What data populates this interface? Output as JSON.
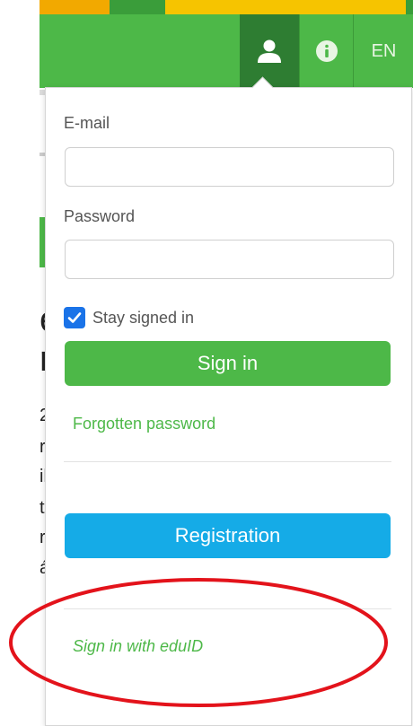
{
  "header": {
    "user_button_icon": "user-icon",
    "info_button_icon": "info-icon",
    "language_label": "EN"
  },
  "login": {
    "email_label": "E-mail",
    "email_value": "",
    "password_label": "Password",
    "password_value": "",
    "stay_signed_in_label": "Stay signed in",
    "stay_signed_in_checked": true,
    "sign_in_label": "Sign in",
    "forgotten_password_label": "Forgotten password",
    "registration_label": "Registration",
    "eduid_label": "Sign in with eduID"
  },
  "background_fragments": [
    "e",
    "r",
    "2",
    "r",
    "ik",
    "t",
    "r",
    "á"
  ],
  "colors": {
    "brand_green": "#4db848",
    "dark_green": "#2e7d32",
    "registration_blue": "#15abe7",
    "checkbox_blue": "#1a73e8",
    "annotation_red": "#e3131b"
  }
}
